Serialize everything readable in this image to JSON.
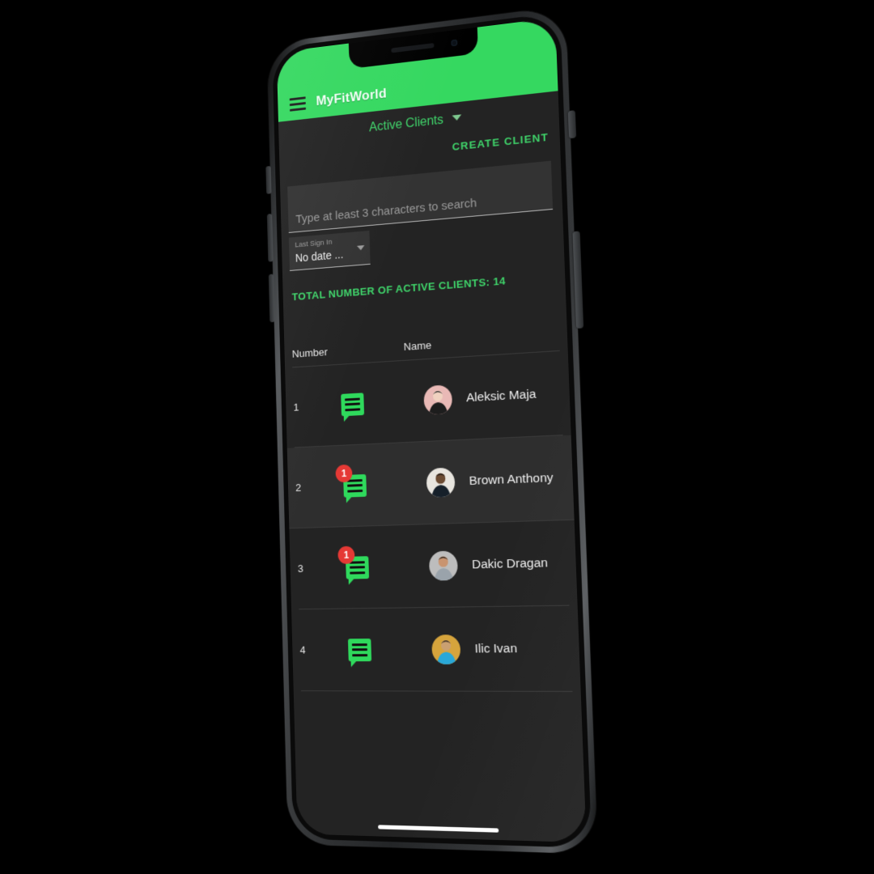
{
  "app": {
    "title": "MyFitWorld",
    "menu_icon": "hamburger-menu-icon",
    "accent_green": "#35D860",
    "screen_bg": "#232323"
  },
  "subheader": {
    "label": "Active Clients",
    "caret_icon": "chevron-down-icon"
  },
  "actions": {
    "create_client": "CREATE CLIENT"
  },
  "search": {
    "value": "",
    "placeholder": "Type at least 3 characters to search"
  },
  "date_filter": {
    "label": "Last Sign In",
    "value": "No date ...",
    "caret_icon": "chevron-down-icon"
  },
  "summary": {
    "total_text": "TOTAL NUMBER OF ACTIVE CLIENTS: 14",
    "total_count": 14
  },
  "table": {
    "columns": [
      "Number",
      "Name"
    ],
    "rows": [
      {
        "number": "1",
        "name": "Aleksic Maja",
        "unread": "",
        "has_badge": false,
        "highlighted": false,
        "avatar": {
          "bg": "#e9b9b6",
          "skin": "#f0d2c0",
          "hair": "#2b2b2b",
          "shirt": "#1d1d1d"
        }
      },
      {
        "number": "2",
        "name": "Brown Anthony",
        "unread": "1",
        "has_badge": true,
        "highlighted": true,
        "avatar": {
          "bg": "#e8e5df",
          "skin": "#6b4b33",
          "hair": "#1a1410",
          "shirt": "#16202a"
        }
      },
      {
        "number": "3",
        "name": "Dakic Dragan",
        "unread": "1",
        "has_badge": true,
        "highlighted": false,
        "avatar": {
          "bg": "#bdbdbd",
          "skin": "#c99470",
          "hair": "#201a16",
          "shirt": "#9aa3ab"
        }
      },
      {
        "number": "4",
        "name": "Ilic Ivan",
        "unread": "",
        "has_badge": false,
        "highlighted": false,
        "avatar": {
          "bg": "#d6a43c",
          "skin": "#caa071",
          "hair": "#2a2018",
          "shirt": "#29a8d8"
        }
      }
    ],
    "chat_icon": "chat-bubble-icon",
    "badge_color": "#e53935"
  },
  "system": {
    "home_indicator": "home-indicator"
  }
}
